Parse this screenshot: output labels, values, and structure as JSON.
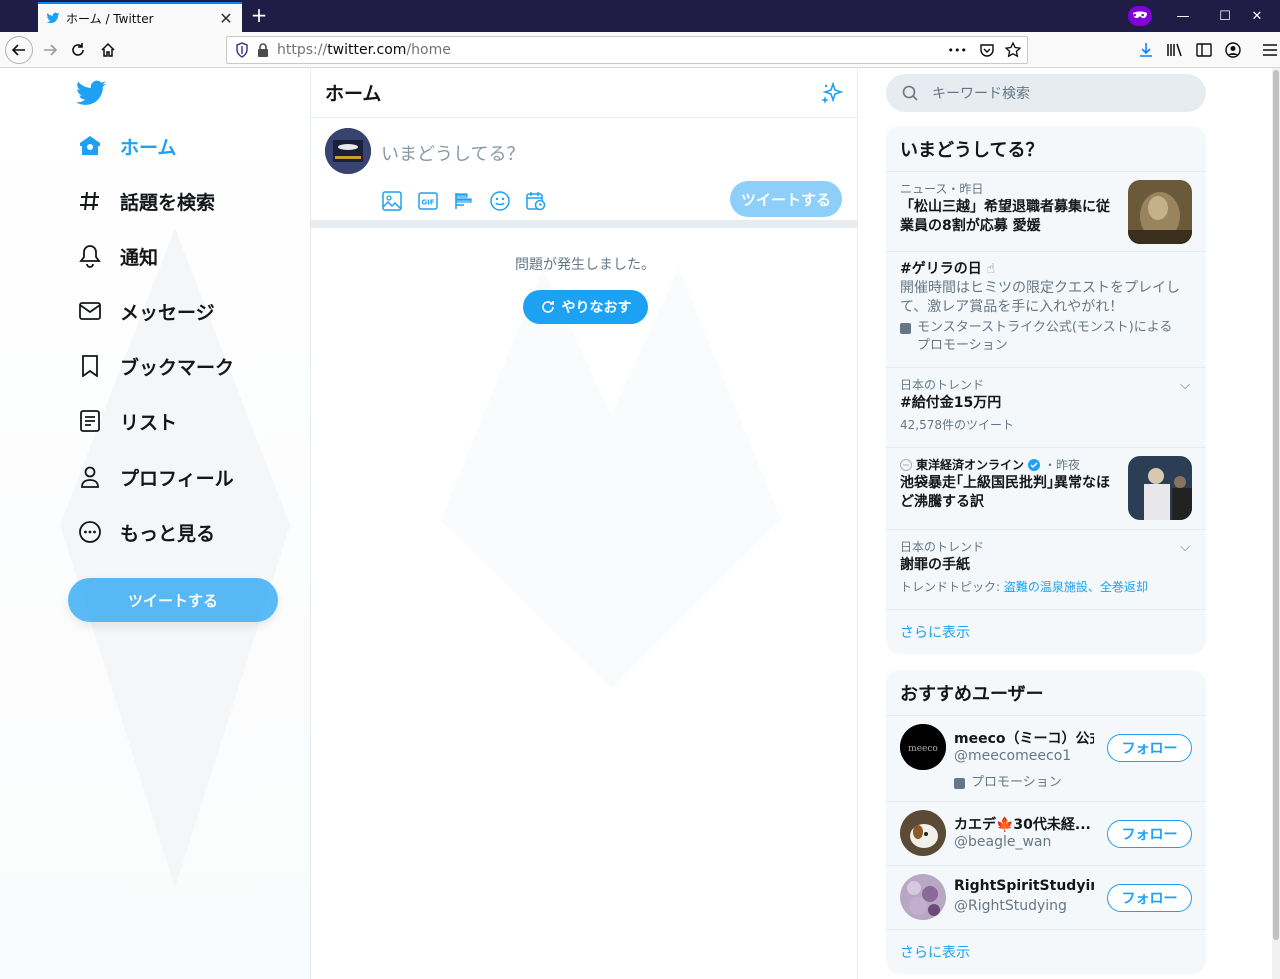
{
  "browser": {
    "tab_title": "ホーム / Twitter",
    "url_protocol": "https://",
    "url_host": "twitter.com",
    "url_path": "/home",
    "new_tab": "+",
    "close": "✕",
    "minimize": "—",
    "maximize": "☐",
    "win_close": "✕",
    "more_dots": "•••"
  },
  "sidebar": {
    "items": [
      {
        "label": "ホーム",
        "icon": "home-icon"
      },
      {
        "label": "話題を検索",
        "icon": "hashtag-icon"
      },
      {
        "label": "通知",
        "icon": "bell-icon"
      },
      {
        "label": "メッセージ",
        "icon": "mail-icon"
      },
      {
        "label": "ブックマーク",
        "icon": "bookmark-icon"
      },
      {
        "label": "リスト",
        "icon": "list-icon"
      },
      {
        "label": "プロフィール",
        "icon": "person-icon"
      },
      {
        "label": "もっと見る",
        "icon": "more-circle-icon"
      }
    ],
    "tweet_button": "ツイートする"
  },
  "main": {
    "title": "ホーム",
    "compose_placeholder": "いまどうしてる？",
    "compose_button": "ツイートする",
    "error_text": "問題が発生しました。",
    "retry_button": "やりなおす"
  },
  "search": {
    "placeholder": "キーワード検索"
  },
  "trends": {
    "title": "いまどうしてる？",
    "items": [
      {
        "meta": "ニュース・昨日",
        "title": "「松山三越」希望退職者募集に従業員の8割が応募 愛媛"
      },
      {
        "title": "#ゲリラの日",
        "desc": "開催時間はヒミツの限定クエストをプレイして、激レア賞品を手に入れやがれ！",
        "promo": "モンスターストライク公式(モンスト)によるプロモーション"
      },
      {
        "meta": "日本のトレンド",
        "title": "#給付金15万円",
        "count": "42,578件のツイート"
      },
      {
        "source": "東洋経済オンライン",
        "time": "・昨夜",
        "title": "池袋暴走｢上級国民批判｣異常なほど沸騰する訳"
      },
      {
        "meta": "日本のトレンド",
        "title": "謝罪の手紙",
        "topic_label": "トレンドトピック: ",
        "topic_links": "盗難の温泉施設、全巻返却"
      }
    ],
    "show_more": "さらに表示"
  },
  "who_to_follow": {
    "title": "おすすめユーザー",
    "users": [
      {
        "name": "meeco（ミーコ）公式",
        "handle": "@meecomeeco1",
        "promo": "プロモーション",
        "follow": "フォロー",
        "avatar_text": "meeco"
      },
      {
        "name": "カエデ🍁30代未経...",
        "handle": "@beagle_wan",
        "follow": "フォロー"
      },
      {
        "name": "RightSpiritStudying",
        "handle": "@RightStudying",
        "follow": "フォロー"
      }
    ],
    "show_more": "さらに表示"
  },
  "colors": {
    "accent": "#1da1f2",
    "titlebar": "#1f1d45",
    "panel": "#f5f8fa"
  }
}
